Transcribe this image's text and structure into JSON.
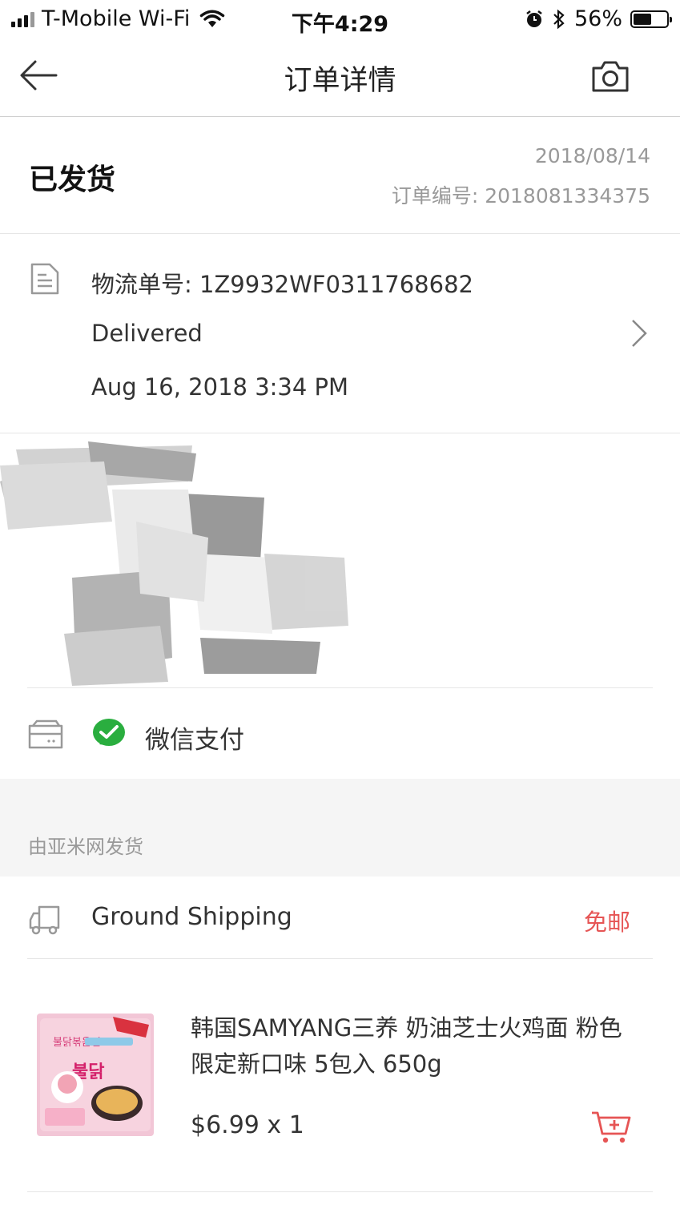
{
  "status_bar": {
    "carrier": "T-Mobile Wi-Fi",
    "time": "下午4:29",
    "battery_pct": "56%",
    "battery_level": 0.56
  },
  "nav": {
    "title": "订单详情",
    "back_icon": "arrow-left-icon",
    "camera_icon": "camera-icon"
  },
  "order": {
    "status": "已发货",
    "date": "2018/08/14",
    "order_number": "订单编号: 2018081334375"
  },
  "tracking": {
    "number": "物流单号: 1Z9932WF0311768682",
    "state": "Delivered",
    "timestamp": "Aug 16, 2018 3:34 PM"
  },
  "payment": {
    "method": "微信支付"
  },
  "shipped_by": "由亚米网发货",
  "shipping": {
    "method": "Ground Shipping",
    "fee": "免邮"
  },
  "product": {
    "name": "韩国SAMYANG三养 奶油芝士火鸡面 粉色限定新口味 5包入 650g",
    "price_qty": "$6.99 x 1"
  },
  "colors": {
    "accent_red": "#e65555",
    "wechat_green": "#2aae3f"
  }
}
